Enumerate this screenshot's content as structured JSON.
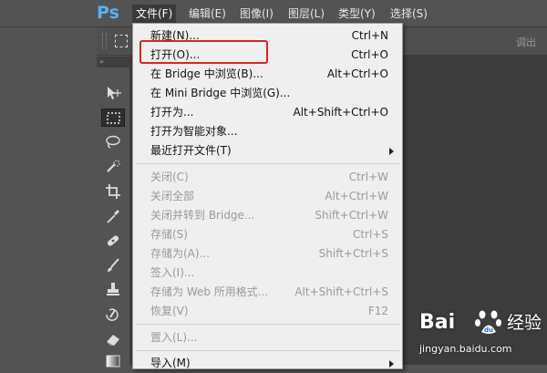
{
  "app": {
    "logo": "Ps"
  },
  "menubar": {
    "items": [
      {
        "label": "文件(F)",
        "active": true
      },
      {
        "label": "编辑(E)"
      },
      {
        "label": "图像(I)"
      },
      {
        "label": "图层(L)"
      },
      {
        "label": "类型(Y)"
      },
      {
        "label": "选择(S)"
      }
    ]
  },
  "optionsbar": {
    "right_label": "调出"
  },
  "toolbar": {
    "header": "»",
    "tools": [
      "move-tool",
      "rectangular-marquee-tool",
      "lasso-tool",
      "quick-selection-tool",
      "crop-tool",
      "eyedropper-tool",
      "spot-healing-brush-tool",
      "brush-tool",
      "clone-stamp-tool",
      "history-brush-tool",
      "eraser-tool",
      "gradient-tool"
    ],
    "selected": "rectangular-marquee-tool"
  },
  "file_menu": {
    "items": [
      {
        "label": "新建(N)...",
        "shortcut": "Ctrl+N",
        "enabled": true
      },
      {
        "label": "打开(O)...",
        "shortcut": "Ctrl+O",
        "enabled": true,
        "highlighted": true
      },
      {
        "label": "在 Bridge 中浏览(B)...",
        "shortcut": "Alt+Ctrl+O",
        "enabled": true
      },
      {
        "label": "在 Mini Bridge 中浏览(G)...",
        "shortcut": "",
        "enabled": true
      },
      {
        "label": "打开为...",
        "shortcut": "Alt+Shift+Ctrl+O",
        "enabled": true
      },
      {
        "label": "打开为智能对象...",
        "shortcut": "",
        "enabled": true
      },
      {
        "label": "最近打开文件(T)",
        "shortcut": "",
        "enabled": true,
        "submenu": true
      },
      {
        "label": "关闭(C)",
        "shortcut": "Ctrl+W",
        "enabled": false
      },
      {
        "label": "关闭全部",
        "shortcut": "Alt+Ctrl+W",
        "enabled": false
      },
      {
        "label": "关闭并转到 Bridge...",
        "shortcut": "Shift+Ctrl+W",
        "enabled": false
      },
      {
        "label": "存储(S)",
        "shortcut": "Ctrl+S",
        "enabled": false
      },
      {
        "label": "存储为(A)...",
        "shortcut": "Shift+Ctrl+S",
        "enabled": false
      },
      {
        "label": "签入(I)...",
        "shortcut": "",
        "enabled": false
      },
      {
        "label": "存储为 Web 所用格式...",
        "shortcut": "Alt+Shift+Ctrl+S",
        "enabled": false
      },
      {
        "label": "恢复(V)",
        "shortcut": "F12",
        "enabled": false
      },
      {
        "label": "置入(L)...",
        "shortcut": "",
        "enabled": false
      },
      {
        "label": "导入(M)",
        "shortcut": "",
        "enabled": true,
        "submenu": true
      }
    ]
  },
  "watermark": {
    "brand": "Bai",
    "brand_suffix": "du",
    "product": "经验",
    "url": "jingyan.baidu.com"
  }
}
